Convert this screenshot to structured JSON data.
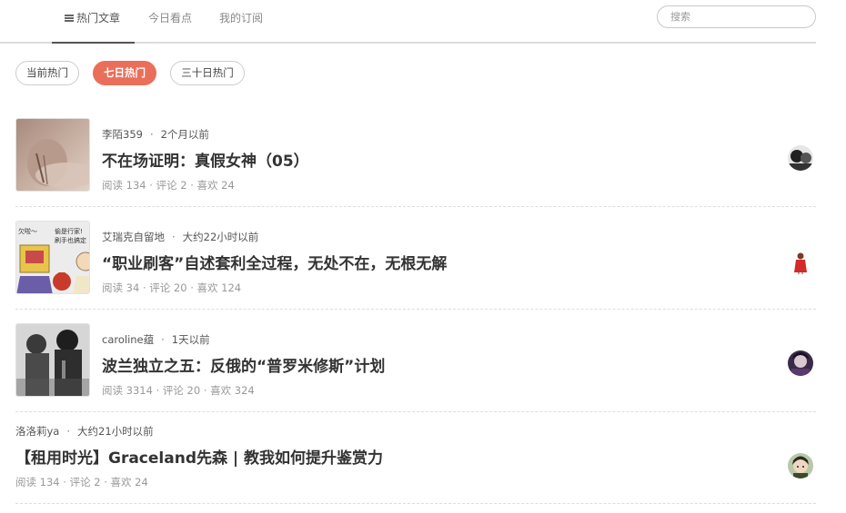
{
  "nav": {
    "tabs": [
      {
        "label": "热门文章",
        "active": true
      },
      {
        "label": "今日看点",
        "active": false
      },
      {
        "label": "我的订阅",
        "active": false
      }
    ],
    "search_placeholder": "搜索"
  },
  "filters": [
    {
      "label": "当前热门",
      "active": false
    },
    {
      "label": "七日热门",
      "active": true
    },
    {
      "label": "三十日热门",
      "active": false
    }
  ],
  "articles": [
    {
      "author": "李陌359",
      "time": "2个月以前",
      "title": "不在场证明：真假女神（05）",
      "stats": "阅读 134 · 评论 2 · 喜欢 24"
    },
    {
      "author": "艾瑞克自留地",
      "time": "大约22小时以前",
      "title": "“职业刷客”自述套利全过程，无处不在，无根无解",
      "stats": "阅读 34 · 评论 20 · 喜欢 124"
    },
    {
      "author": "caroline蕴",
      "time": "1天以前",
      "title": "波兰独立之五：反俄的“普罗米修斯”计划",
      "stats": "阅读 3314 · 评论 20 · 喜欢 324"
    },
    {
      "author": "洛洛莉ya",
      "time": "大约21小时以前",
      "title": "【租用时光】Graceland先森 | 教我如何提升鉴赏力",
      "stats": "阅读 134 · 评论 2 · 喜欢 24"
    }
  ],
  "thumb_lettering": {
    "t2": "欠啦～ 偷是行家! 刷手也搞定"
  },
  "colors": {
    "accent": "#ea6f5a",
    "text": "#333333",
    "muted": "#999999"
  }
}
